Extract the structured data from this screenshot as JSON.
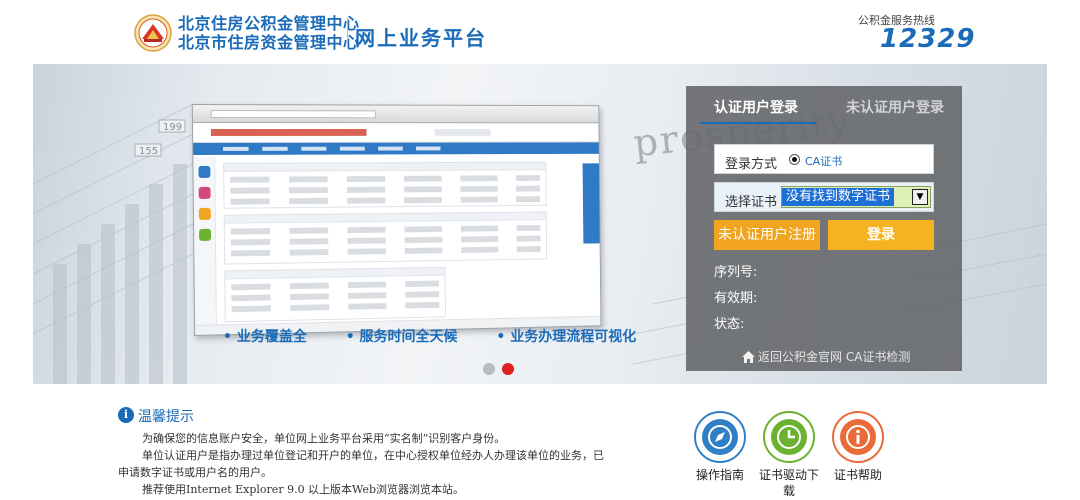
{
  "header": {
    "org_name_line1": "北京住房公积金管理中心",
    "org_name_line2": "北京市住房资金管理中心",
    "platform_title": "网上业务平台",
    "hotline_label": "公积金服务热线",
    "hotline_number": "12329"
  },
  "banner": {
    "background_word": "prosperity",
    "slogans": [
      "• 业务覆盖全",
      "• 服务时间全天候",
      "• 业务办理流程可视化"
    ],
    "carousel": {
      "slide_count": 2,
      "active_index": 1
    }
  },
  "login": {
    "tabs": [
      {
        "label": "认证用户登录",
        "active": true
      },
      {
        "label": "未认证用户登录",
        "active": false
      }
    ],
    "method_label": "登录方式",
    "method_option": "CA证书",
    "cert_label": "选择证书",
    "cert_selected": "没有找到数字证书",
    "register_button": "未认证用户注册",
    "login_button": "登录",
    "serial_label": "序列号:",
    "validity_label": "有效期:",
    "status_label": "状态:",
    "back_link": "返回公积金官网",
    "check_link": "CA证书检测"
  },
  "tips": {
    "title": "温馨提示",
    "paragraphs": [
      "为确保您的信息账户安全，单位网上业务平台采用“实名制”识别客户身份。",
      "单位认证用户是指办理过单位登记和开户的单位，在中心授权单位经办人办理该单位的业务，已申请数字证书或用户名的用户。",
      "推荐使用Internet Explorer 9.0 以上版本Web浏览器浏览本站。"
    ]
  },
  "quick_links": [
    {
      "label": "操作指南",
      "icon": "compass-icon",
      "color": "#2f7fc7"
    },
    {
      "label": "证书驱动下载",
      "icon": "clock-icon",
      "color": "#6ab22f"
    },
    {
      "label": "证书帮助",
      "icon": "info-icon",
      "color": "#ea6a3a"
    }
  ],
  "colors": {
    "brand_blue": "#1b6bb9",
    "login_button": "#f6b321",
    "panel_gray": "#66686c",
    "carousel_active": "#e01f1f"
  }
}
